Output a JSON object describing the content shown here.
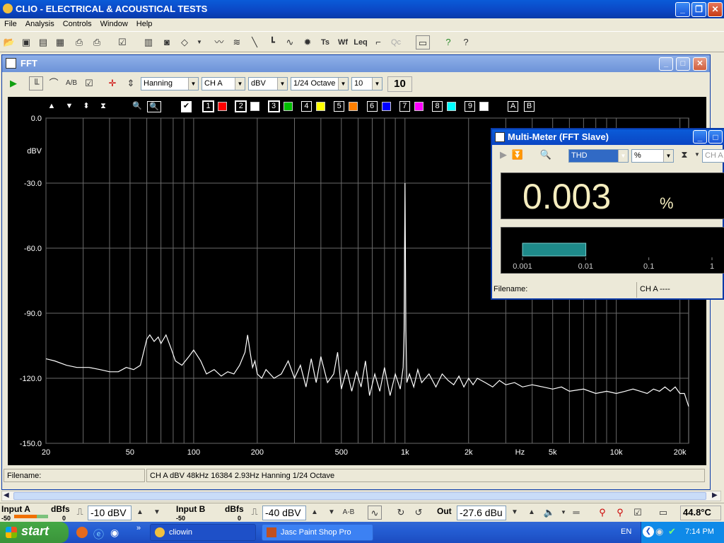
{
  "app": {
    "title": "CLIO - ELECTRICAL & ACOUSTICAL TESTS"
  },
  "menu": [
    "File",
    "Analysis",
    "Controls",
    "Window",
    "Help"
  ],
  "fft_window": {
    "title": "FFT",
    "window_fn": "Hanning",
    "channel": "CH A",
    "units": "dBV",
    "smoothing": "1/24 Octave",
    "range": "10",
    "range_display": "10",
    "status": {
      "filename_label": "Filename:",
      "info": "CH A   dBV   48kHz   16384   2.93Hz   Hanning   1/24 Octave"
    },
    "curve_numbers": [
      "1",
      "2",
      "3",
      "4",
      "5",
      "6",
      "7",
      "8",
      "9"
    ],
    "curve_colors": [
      "#ff0000",
      "#ffffff",
      "#00c000",
      "#ffff00",
      "#ff8000",
      "#0000ff",
      "#ff00ff",
      "#00ffff",
      "#ffffff"
    ],
    "curve_letters": [
      "A",
      "B"
    ]
  },
  "chart_data": {
    "type": "line",
    "title": "",
    "xlabel": "Hz",
    "ylabel": "dBV",
    "x_scale": "log",
    "xlim": [
      20,
      22000
    ],
    "ylim": [
      -150,
      0
    ],
    "y_tick_labels": [
      "0.0",
      "dBV",
      "-30.0",
      "-60.0",
      "-90.0",
      "-120.0",
      "-150.0"
    ],
    "x_tick_labels": [
      {
        "v": 20,
        "label": "20"
      },
      {
        "v": 50,
        "label": "50"
      },
      {
        "v": 100,
        "label": "100"
      },
      {
        "v": 200,
        "label": "200"
      },
      {
        "v": 500,
        "label": "500"
      },
      {
        "v": 1000,
        "label": "1k"
      },
      {
        "v": 2000,
        "label": "2k"
      },
      {
        "v": 3500,
        "label": "Hz"
      },
      {
        "v": 5000,
        "label": "5k"
      },
      {
        "v": 10000,
        "label": "10k"
      },
      {
        "v": 20000,
        "label": "20k"
      }
    ],
    "grid": true,
    "series": [
      {
        "color": "#ffffff",
        "x": [
          20,
          22,
          25,
          28,
          32,
          36,
          40,
          44,
          48,
          52,
          56,
          60,
          62,
          65,
          68,
          70,
          74,
          78,
          82,
          88,
          95,
          100,
          108,
          115,
          125,
          135,
          145,
          155,
          165,
          175,
          180,
          185,
          190,
          195,
          200,
          210,
          220,
          240,
          260,
          280,
          300,
          320,
          340,
          360,
          380,
          400,
          430,
          460,
          480,
          500,
          530,
          560,
          590,
          620,
          650,
          680,
          720,
          760,
          800,
          850,
          900,
          950,
          980,
          990,
          1000,
          1010,
          1020,
          1050,
          1100,
          1150,
          1200,
          1300,
          1400,
          1500,
          1600,
          1700,
          1800,
          1900,
          2000,
          2100,
          2200,
          2400,
          2600,
          2800,
          3000,
          3300,
          3600,
          4000,
          4500,
          5000,
          5500,
          6000,
          7000,
          8000,
          9000,
          10000,
          11000,
          12000,
          13000,
          14000,
          15000,
          16000,
          17000,
          18000,
          19000,
          20000,
          21000,
          22000
        ],
        "y": [
          -111,
          -112,
          -114,
          -115,
          -115,
          -116,
          -117,
          -117,
          -115,
          -116,
          -114,
          -102,
          -100,
          -103,
          -101,
          -104,
          -100,
          -106,
          -112,
          -114,
          -110,
          -107,
          -112,
          -118,
          -116,
          -119,
          -117,
          -118,
          -114,
          -108,
          -100,
          -108,
          -115,
          -112,
          -118,
          -120,
          -116,
          -120,
          -118,
          -112,
          -120,
          -114,
          -124,
          -111,
          -122,
          -110,
          -122,
          -118,
          -108,
          -125,
          -116,
          -126,
          -117,
          -124,
          -112,
          -128,
          -118,
          -126,
          -115,
          -128,
          -118,
          -125,
          -115,
          -98,
          -30,
          -98,
          -122,
          -118,
          -124,
          -116,
          -122,
          -118,
          -124,
          -118,
          -121,
          -123,
          -119,
          -124,
          -120,
          -123,
          -120,
          -122,
          -124,
          -121,
          -123,
          -122,
          -124,
          -123,
          -124,
          -125,
          -124,
          -126,
          -125,
          -127,
          -126,
          -127,
          -126,
          -125,
          -126,
          -127,
          -125,
          -126,
          -124,
          -126,
          -124,
          -127,
          -127,
          -133
        ]
      }
    ]
  },
  "multimeter": {
    "title": "Multi-Meter (FFT Slave)",
    "measure": "THD",
    "unit_select": "%",
    "channel_field": "CH A",
    "value": "0.003",
    "unit": "%",
    "scale_labels": [
      "0.001",
      "0.01",
      "0.1",
      "1"
    ],
    "bar_level": 0.003,
    "filename_label": "Filename:",
    "channel_status": "CH A   ----"
  },
  "controls": {
    "input_a_label": "Input A",
    "input_b_label": "Input B",
    "dbfs": "dBfs",
    "scale_min": "-50",
    "scale_max": "0",
    "input_a_range": "-10 dBV",
    "input_b_range": "-40 dBV",
    "ab_label": "A-B",
    "out_label": "Out",
    "out_level": "-27.6 dBu",
    "temperature": "44.8°C"
  },
  "taskbar": {
    "start": "start",
    "tasks": [
      "cliowin",
      "Jasc Paint Shop Pro"
    ],
    "lang": "EN",
    "time": "7:14 PM"
  }
}
